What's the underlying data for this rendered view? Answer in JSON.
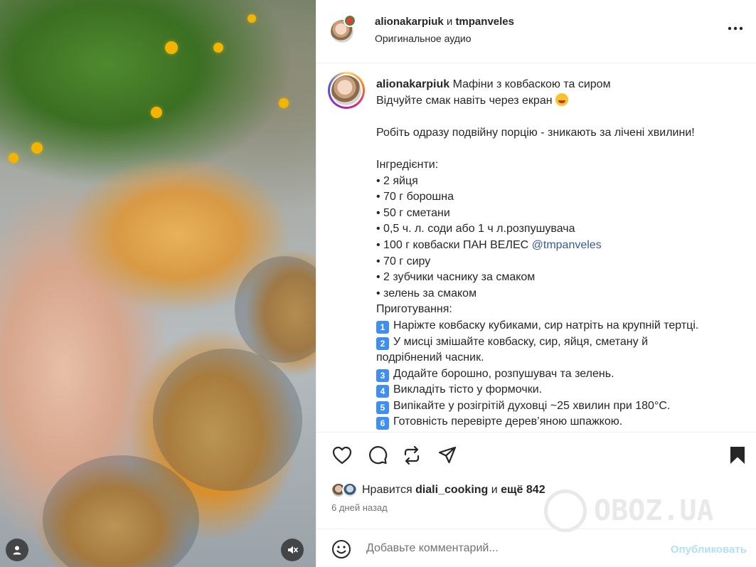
{
  "header": {
    "user1": "alionakarpiuk",
    "joiner": "и",
    "user2": "tmpanveles",
    "audio": "Оригинальное аудио"
  },
  "caption": {
    "username": "alionakarpiuk",
    "title": "Мафіни з ковбаскою та сиром",
    "line2": "Відчуйте смак навіть через екран",
    "line3": "Робіть одразу подвійну порцію - зникають за лічені хвилини!",
    "ingredients_heading": "Інгредієнти:",
    "ingredients": [
      "• 2 яйця",
      "• 70 г борошна",
      "• 50 г сметани",
      "• 0,5 ч. л. соди або 1 ч л.розпушувача",
      "• 100 г ковбаски ПАН ВЕЛЕС",
      "• 70 г сиру",
      "• 2 зубчики часнику за смаком",
      "• зелень за смаком"
    ],
    "mention": "@tmpanveles",
    "steps_heading": "Приготування:",
    "steps": [
      {
        "n": "1",
        "text": "Наріжте ковбаску кубиками, сир натріть на крупній тертці."
      },
      {
        "n": "2",
        "text": "У мисці змішайте ковбаску, сир, яйця, сметану й"
      },
      {
        "n": "",
        "text": "подрібнений часник."
      },
      {
        "n": "3",
        "text": "Додайте борошно, розпушувач та зелень."
      },
      {
        "n": "4",
        "text": "Викладіть тісто у формочки."
      },
      {
        "n": "5",
        "text": "Випікайте у розігрітій духовці ~25 хвилин при 180°C."
      },
      {
        "n": "6",
        "text": "Готовність перевірте дерев’яною шпажкою."
      }
    ]
  },
  "likes": {
    "prefix": "Нравится",
    "user": "diali_cooking",
    "middle": "и",
    "more": "ещё 842"
  },
  "time": "6 дней назад",
  "comment": {
    "placeholder": "Добавьте комментарий...",
    "publish": "Опубликовать"
  },
  "watermark": "OBOZ.UA",
  "icons": {
    "more": "more-horizontal-icon",
    "like": "heart-icon",
    "comment": "comment-icon",
    "repost": "repost-icon",
    "share": "share-icon",
    "save": "bookmark-icon",
    "emoji": "emoji-icon",
    "user": "user-icon",
    "mute": "muted-speaker-icon"
  },
  "colors": {
    "mention": "#385898",
    "publish_disabled": "#b2dffc",
    "step_badge": "#3f8ef0"
  }
}
